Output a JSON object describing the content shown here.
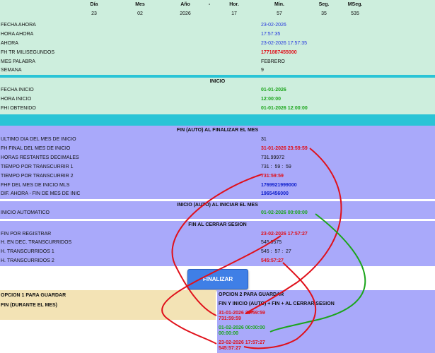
{
  "header": {
    "columns": [
      {
        "label": "Día",
        "value": "23"
      },
      {
        "label": "Mes",
        "value": "02"
      },
      {
        "label": "Año",
        "value": "2026"
      },
      {
        "label": "-",
        "value": ""
      },
      {
        "label": "Hor.",
        "value": "17"
      },
      {
        "label": "Min.",
        "value": "57"
      },
      {
        "label": "Seg.",
        "value": "35"
      },
      {
        "label": "MSeg.",
        "value": "535"
      }
    ]
  },
  "now_section": {
    "rows": [
      {
        "label": "FECHA AHORA",
        "value": "23-02-2026"
      },
      {
        "label": "HORA AHORA",
        "value": "17:57:35"
      },
      {
        "label": "AHORA",
        "value": "23-02-2026 17:57:35"
      },
      {
        "label": "FH TR MILISEGUNDOS",
        "value": "1771887455000"
      },
      {
        "label": "MES PALABRA",
        "value": "FEBRERO"
      },
      {
        "label": "SEMANA",
        "value": "9"
      }
    ]
  },
  "inicio_section": {
    "title": "INICIO",
    "rows": [
      {
        "label": "FECHA INICIO",
        "value": "01-01-2026"
      },
      {
        "label": "HORA INICIO",
        "value": "12:00:00"
      },
      {
        "label": "FHI OBTENIDO",
        "value": "01-01-2026 12:00:00"
      }
    ]
  },
  "fin_auto_section": {
    "title": "FIN (AUTO) AL FINALIZAR EL MES",
    "rows": [
      {
        "label": "ULTIMO DIA DEL MES DE INICIO",
        "value": "31"
      },
      {
        "label": "FH FINAL DEL MES DE INICIO",
        "value": "31-01-2026 23:59:59"
      },
      {
        "label": "HORAS RESTANTES DECIMALES",
        "value": "731.99972"
      },
      {
        "label": "TIEMPO POR TRANSCURRIR 1",
        "value": "731 :  59 :  59"
      },
      {
        "label": "TIEMPO POR TRANSCURRIR 2",
        "value": "731:59:59"
      },
      {
        "label": "FHF DEL MES DE INICIO MLS",
        "value": "1769921999000"
      },
      {
        "label": "DIF. AHORA - FIN DE MES DE INIC",
        "value": "1965456000"
      }
    ]
  },
  "inicio_auto_section": {
    "title": "INICIO (AUTO) AL INICIAR EL MES",
    "rows": [
      {
        "label": "INICIO AUTOMATICO",
        "value": "01-02-2026 00:00:00"
      }
    ]
  },
  "fin_cerrar_section": {
    "title": "FIN AL CERRAR SESION",
    "rows": [
      {
        "label": "FIN POR REGISTRAR",
        "value": "23-02-2026 17:57:27"
      },
      {
        "label": "H. EN DEC. TRANSCURRIDOS",
        "value": "545.9575"
      },
      {
        "label": "H. TRANSCURRIDOS 1",
        "value": "545 :  57 :  27"
      },
      {
        "label": "H. TRANSCURRIDOS 2",
        "value": "545:57:27"
      }
    ]
  },
  "finalizar_button": "FINALIZAR",
  "opcion1": {
    "title": "OPCION 1 PARA GUARDAR",
    "subtitle": "FIN (DURANTE EL MES)"
  },
  "opcion2": {
    "title": "OPCION 2 PARA GUARDAR",
    "subtitle": "FIN Y INICIO (AUTO) + FIN + AL CERRAR SESION",
    "entries": [
      {
        "line1": "31-01-2026 23:59:59",
        "line2": "731:59:59"
      },
      {
        "line1": "01-02-2026 00:00:00",
        "line2": "00:00:00"
      },
      {
        "line1": "23-02-2026 17:57:27",
        "line2": "545:57:27"
      }
    ]
  },
  "colors": {
    "mint": "#cdeedd",
    "cyan": "#29c4d6",
    "lavender": "#a9a9fa",
    "beige": "#f3e3b5",
    "accent_red": "#e0101a",
    "accent_green": "#1ba51b"
  }
}
